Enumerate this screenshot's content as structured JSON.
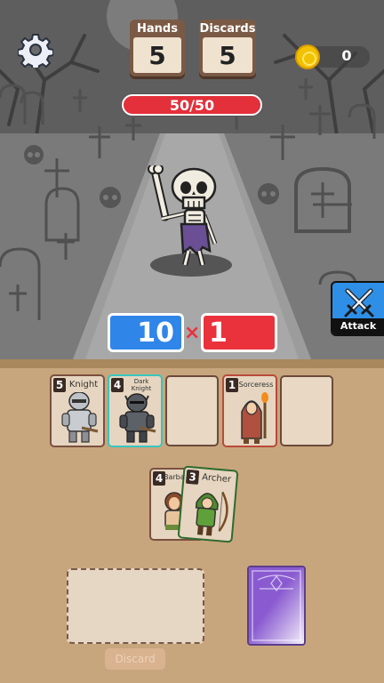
{
  "hud": {
    "hands_label": "Hands",
    "hands_value": "5",
    "discards_label": "Discards",
    "discards_value": "5",
    "coins": "0"
  },
  "enemy": {
    "hp_text": "50/50",
    "hp_fraction": 1.0
  },
  "score": {
    "chips": "10",
    "times": "×",
    "mult": "1"
  },
  "attack_label": "Attack",
  "played_slots": [
    {
      "cost": "5",
      "name": "Knight"
    },
    {
      "cost": "4",
      "name": "Dark Knight"
    },
    null,
    {
      "cost": "1",
      "name": "Sorceress"
    },
    null
  ],
  "hand": [
    {
      "cost": "4",
      "name": "Barba"
    },
    {
      "cost": "3",
      "name": "Archer"
    }
  ],
  "discard_label": "Discard",
  "colors": {
    "hp_bar": "#e3303b",
    "chips": "#2f85e8",
    "mult": "#e9323c",
    "attack_bg": "#2f8fe6",
    "table": "#c8a67d"
  }
}
